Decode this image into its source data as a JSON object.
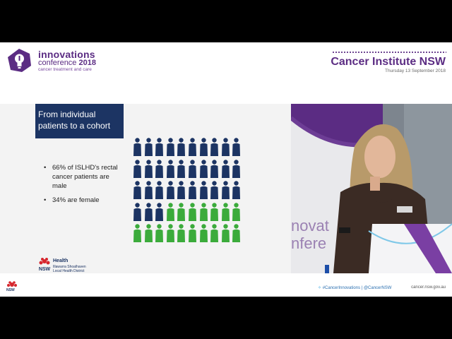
{
  "header": {
    "conference_title": "innovations",
    "conference_line2_prefix": "conference ",
    "conference_year": "2018",
    "conference_tagline": "cancer treatment and care",
    "institute_name": "Cancer Institute NSW",
    "date": "Thursday 13 September 2018"
  },
  "slide": {
    "title": "From individual patients to a cohort",
    "bullets": [
      "66% of ISLHD's rectal cancer patients are male",
      "34% are female"
    ],
    "pictogram": {
      "male_count": 33,
      "female_count": 17,
      "male_color": "#1c3463",
      "female_color": "#3bab3b",
      "male_share": 0.66,
      "female_share": 0.34
    },
    "health_logo": {
      "label": "Health",
      "district": "Illawarra Shoalhaven Local Health District",
      "state": "NSW"
    }
  },
  "footer": {
    "nsw": "NSW",
    "social": "#CancerInnovations | @CancerNSW",
    "url": "cancer.nsw.gov.au"
  },
  "colors": {
    "brand_purple": "#5b2c83",
    "navy": "#1c3463",
    "green": "#3bab3b"
  }
}
